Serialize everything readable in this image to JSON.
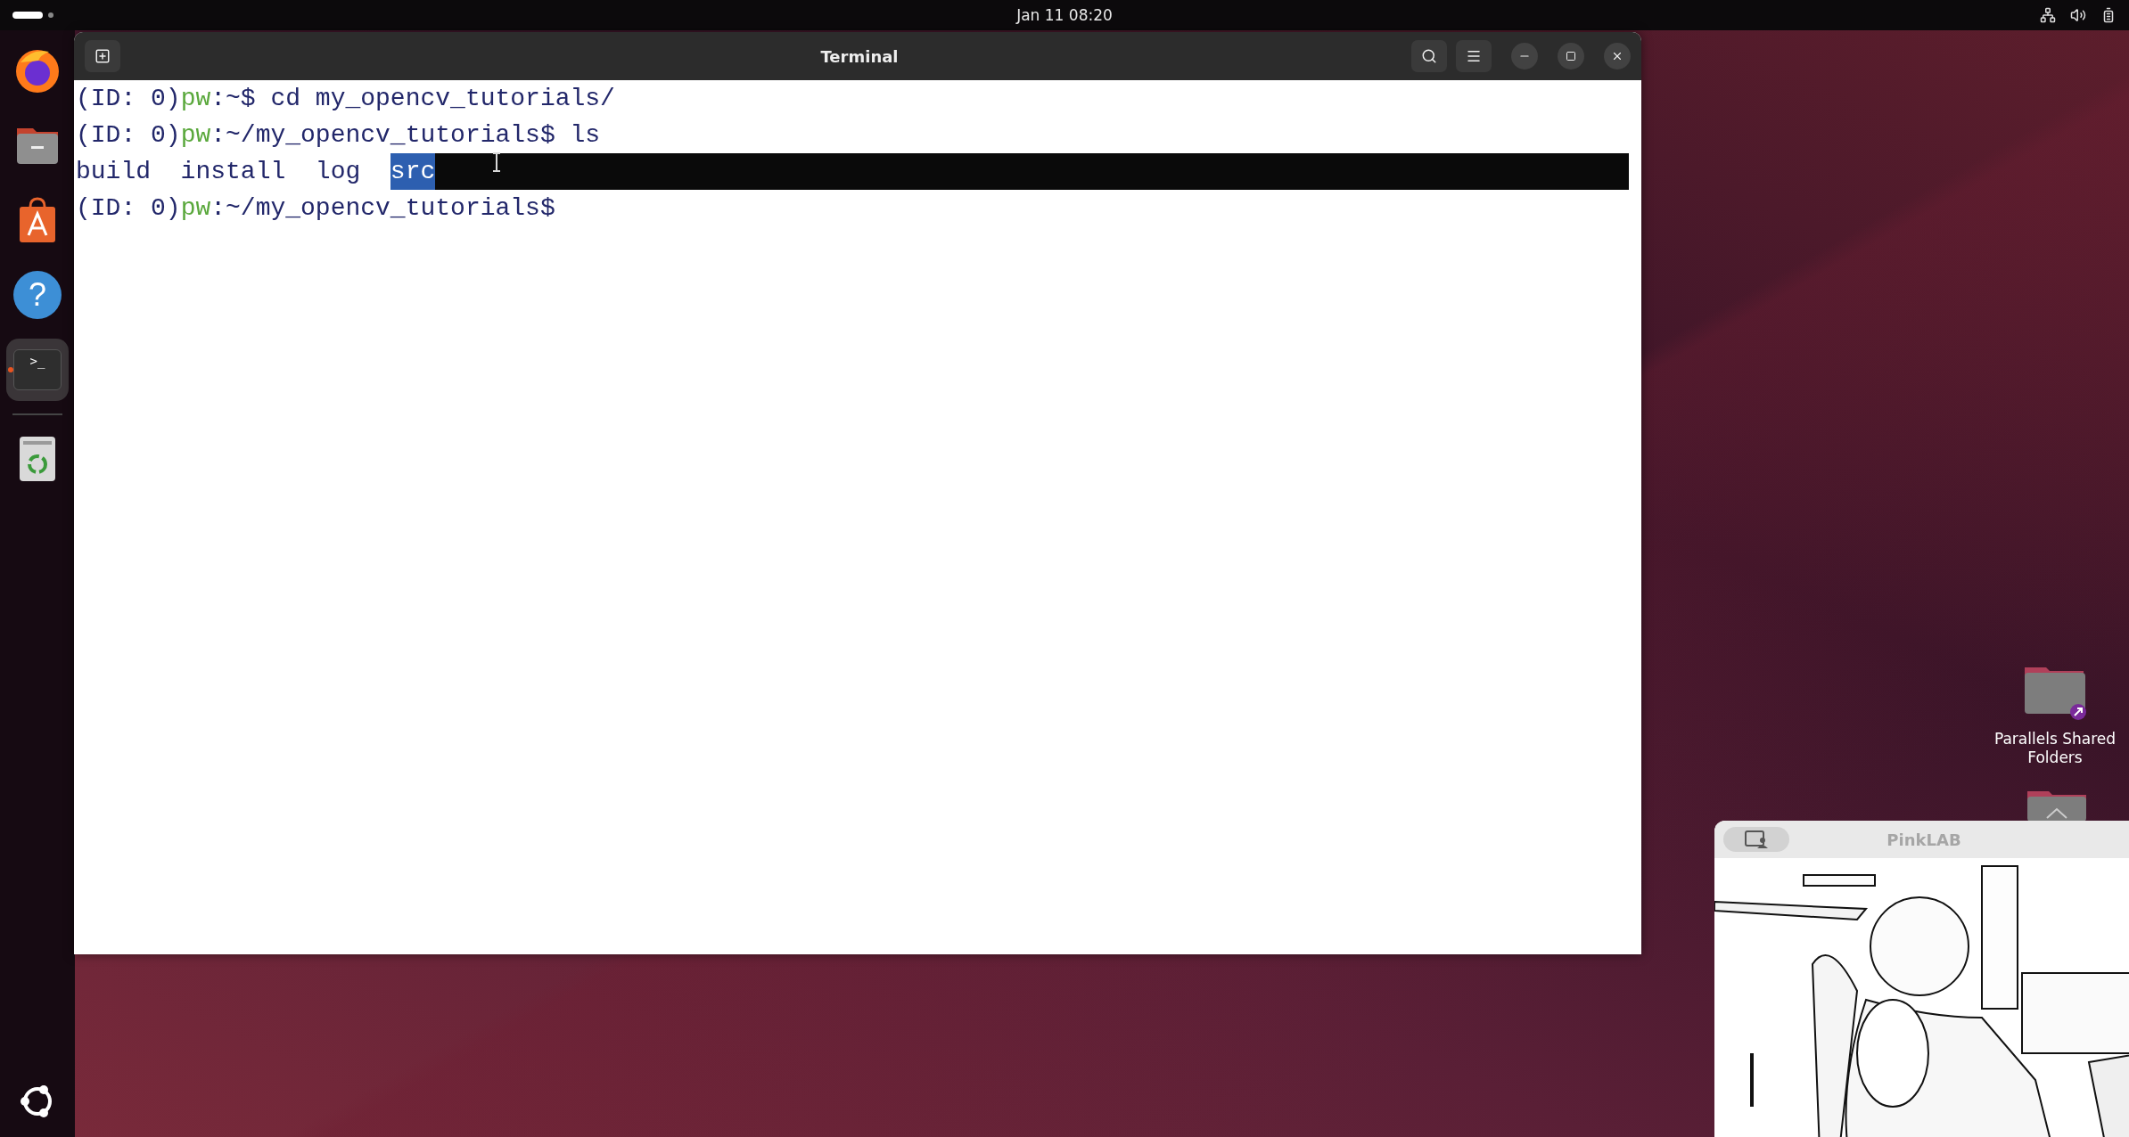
{
  "top_bar": {
    "date": "Jan 11",
    "time": "08:20"
  },
  "dock": {
    "items": [
      {
        "kind": "firefox",
        "selected": false,
        "running": false
      },
      {
        "kind": "files",
        "selected": false,
        "running": false
      },
      {
        "kind": "appstore",
        "selected": false,
        "running": false
      },
      {
        "kind": "help",
        "glyph": "?",
        "selected": false,
        "running": false
      },
      {
        "kind": "terminal",
        "glyph": ">_",
        "selected": true,
        "running": true
      },
      {
        "kind": "trash",
        "selected": false,
        "running": false
      }
    ]
  },
  "terminal": {
    "title": "Terminal",
    "lines": [
      {
        "marked": false,
        "segments": [
          {
            "kind": "id",
            "text": "(ID: 0)"
          },
          {
            "kind": "user",
            "text": "pw"
          },
          {
            "kind": "path",
            "text": ":~$ cd my_opencv_tutorials/"
          }
        ]
      },
      {
        "marked": false,
        "segments": [
          {
            "kind": "id",
            "text": "(ID: 0)"
          },
          {
            "kind": "user",
            "text": "pw"
          },
          {
            "kind": "path",
            "text": ":~/my_opencv_tutorials$ ls"
          }
        ]
      },
      {
        "marked": true,
        "segments": [
          {
            "kind": "path",
            "text": "build  install  log  "
          },
          {
            "kind": "selected",
            "text": "src"
          }
        ]
      },
      {
        "marked": false,
        "segments": [
          {
            "kind": "id",
            "text": "(ID: 0)"
          },
          {
            "kind": "user",
            "text": "pw"
          },
          {
            "kind": "path",
            "text": ":~/my_opencv_tutorials$"
          }
        ]
      }
    ]
  },
  "desktop_icons": [
    {
      "label": "Parallels Shared Folders"
    }
  ],
  "camera_window": {
    "title": "PinkLAB"
  }
}
